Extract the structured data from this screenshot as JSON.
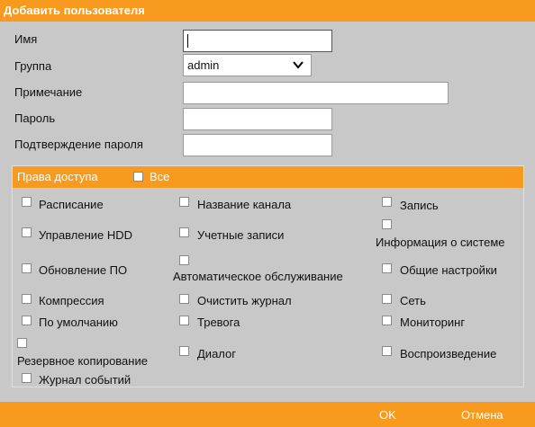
{
  "dialog": {
    "title": "Добавить пользователя"
  },
  "form": {
    "name_label": "Имя",
    "name_value": "",
    "group_label": "Группа",
    "group_value": "admin",
    "note_label": "Примечание",
    "note_value": "",
    "password_label": "Пароль",
    "password_value": "",
    "confirm_label": "Подтверждение пароля",
    "confirm_value": ""
  },
  "rights": {
    "header": "Права доступа",
    "all_label": "Все",
    "items": [
      "Расписание",
      "Название канала",
      "Запись",
      "Управление HDD",
      "Учетные записи",
      "Информация о системе",
      "Обновление ПО",
      "Автоматическое обслуживание",
      "Общие настройки",
      "Компрессия",
      "Очистить журнал",
      "Сеть",
      "По умолчанию",
      "Тревога",
      "Мониторинг",
      "Резервное копирование",
      "Диалог",
      "Воспроизведение",
      "Журнал событий"
    ]
  },
  "footer": {
    "ok_label": "OK",
    "cancel_label": "Отмена"
  },
  "colors": {
    "accent": "#f79a1e",
    "background": "#c8c8c8"
  }
}
